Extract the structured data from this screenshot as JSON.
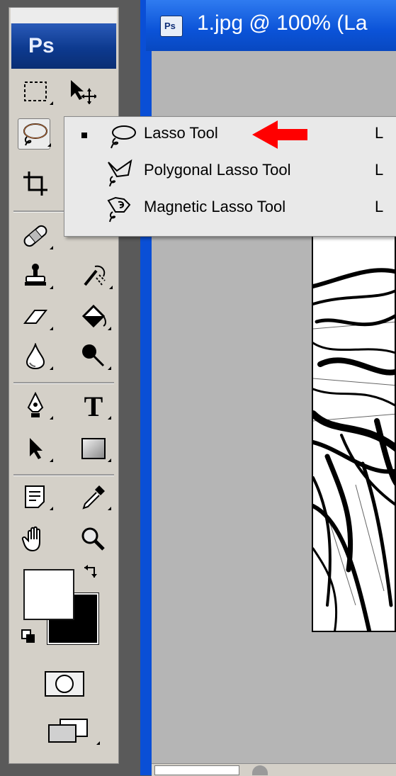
{
  "app": {
    "logo": "Ps"
  },
  "document": {
    "title": "1.jpg @ 100% (La",
    "icon_label": "Ps"
  },
  "toolbox": {
    "tools": [
      {
        "name": "rectangular-marquee-tool",
        "icon": "marquee-icon"
      },
      {
        "name": "move-tool",
        "icon": "move-icon"
      },
      {
        "name": "lasso-tool",
        "icon": "lasso-icon",
        "active": true
      },
      {
        "name": "crop-tool",
        "icon": "crop-icon"
      },
      {
        "name": "healing-brush-tool",
        "icon": "bandage-icon"
      },
      {
        "name": "clone-stamp-tool",
        "icon": "stamp-icon"
      },
      {
        "name": "history-brush-tool",
        "icon": "history-brush-icon"
      },
      {
        "name": "eraser-tool",
        "icon": "eraser-icon"
      },
      {
        "name": "paint-bucket-tool",
        "icon": "paint-bucket-icon"
      },
      {
        "name": "blur-tool",
        "icon": "drop-icon"
      },
      {
        "name": "burn-tool",
        "icon": "burn-icon"
      },
      {
        "name": "pen-tool",
        "icon": "pen-icon"
      },
      {
        "name": "type-tool",
        "icon": "type-icon",
        "glyph": "T"
      },
      {
        "name": "path-selection-tool",
        "icon": "arrow-icon"
      },
      {
        "name": "rectangle-tool",
        "icon": "rectangle-icon"
      },
      {
        "name": "notes-tool",
        "icon": "notes-icon"
      },
      {
        "name": "eyedropper-tool",
        "icon": "eyedropper-icon"
      },
      {
        "name": "hand-tool",
        "icon": "hand-icon"
      },
      {
        "name": "zoom-tool",
        "icon": "magnifier-icon"
      }
    ],
    "foreground_color": "#ffffff",
    "background_color": "#000000"
  },
  "flyout_menu": {
    "items": [
      {
        "label": "Lasso Tool",
        "shortcut": "L",
        "selected": true,
        "icon": "lasso-icon"
      },
      {
        "label": "Polygonal Lasso Tool",
        "shortcut": "L",
        "selected": false,
        "icon": "polygonal-lasso-icon"
      },
      {
        "label": "Magnetic Lasso Tool",
        "shortcut": "L",
        "selected": false,
        "icon": "magnetic-lasso-icon"
      }
    ]
  },
  "colors": {
    "annotation_arrow": "#ff0000",
    "title_bar": "#0b53d8",
    "canvas_bg": "#b5b5b5"
  }
}
